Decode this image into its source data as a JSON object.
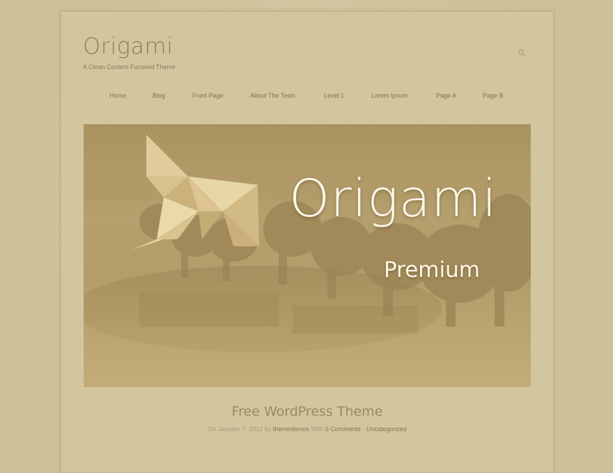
{
  "site": {
    "title": "Origami",
    "tagline": "A Clean Content Focused Theme"
  },
  "search": {
    "icon": "search-icon"
  },
  "nav": {
    "items": [
      {
        "label": "Home"
      },
      {
        "label": "Blog"
      },
      {
        "label": "Front Page"
      },
      {
        "label": "About The Tests"
      },
      {
        "label": "Level 1"
      },
      {
        "label": "Lorem Ipsum"
      },
      {
        "label": "Page A"
      },
      {
        "label": "Page B"
      }
    ]
  },
  "hero": {
    "title": "Origami",
    "subtitle": "Premium",
    "logo_icon": "origami-bird-icon"
  },
  "post": {
    "title": "Free WordPress Theme",
    "meta_on": "On",
    "date": "January 7, 2012",
    "meta_by": "by",
    "author": "themedemos",
    "meta_with": "With",
    "comments": "0 Comments",
    "meta_sep": "-",
    "category": "Uncategorized"
  },
  "colors": {
    "background": "#cdbf97",
    "page": "#d3c69f",
    "hero_tint": "#b7a271",
    "text_light": "#fbf6e8"
  }
}
